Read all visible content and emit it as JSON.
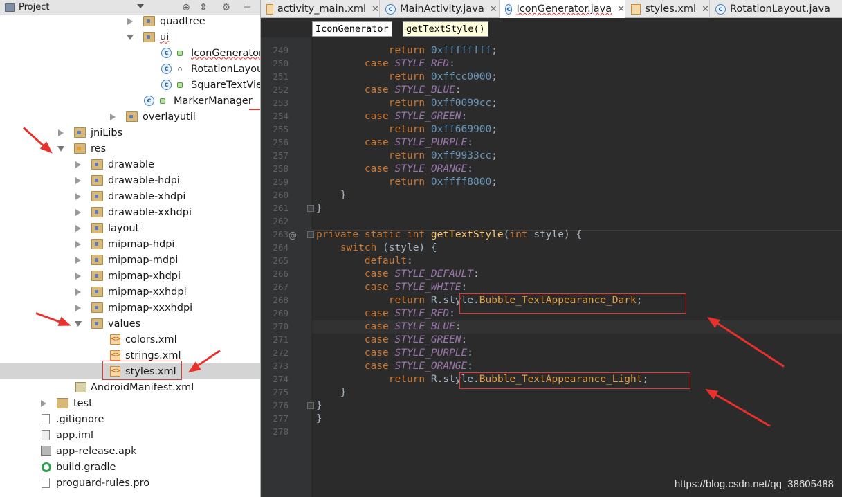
{
  "project_panel": {
    "title": "Project",
    "header_icons": [
      "target-icon",
      "collapse-icon",
      "gear-icon",
      "hide-icon"
    ],
    "tree": [
      {
        "label": "quadtree",
        "type": "folder"
      },
      {
        "label": "ui",
        "type": "folder"
      },
      {
        "label": "IconGenerator",
        "type": "class"
      },
      {
        "label": "RotationLayout",
        "type": "class"
      },
      {
        "label": "SquareTextView",
        "type": "class"
      },
      {
        "label": "MarkerManager",
        "type": "class"
      },
      {
        "label": "overlayutil",
        "type": "folder"
      },
      {
        "label": "jniLibs",
        "type": "folder"
      },
      {
        "label": "res",
        "type": "folder"
      },
      {
        "label": "drawable",
        "type": "folder"
      },
      {
        "label": "drawable-hdpi",
        "type": "folder"
      },
      {
        "label": "drawable-xhdpi",
        "type": "folder"
      },
      {
        "label": "drawable-xxhdpi",
        "type": "folder"
      },
      {
        "label": "layout",
        "type": "folder"
      },
      {
        "label": "mipmap-hdpi",
        "type": "folder"
      },
      {
        "label": "mipmap-mdpi",
        "type": "folder"
      },
      {
        "label": "mipmap-xhdpi",
        "type": "folder"
      },
      {
        "label": "mipmap-xxhdpi",
        "type": "folder"
      },
      {
        "label": "mipmap-xxxhdpi",
        "type": "folder"
      },
      {
        "label": "values",
        "type": "folder"
      },
      {
        "label": "colors.xml",
        "type": "xml"
      },
      {
        "label": "strings.xml",
        "type": "xml"
      },
      {
        "label": "styles.xml",
        "type": "xml",
        "selected": true
      },
      {
        "label": "AndroidManifest.xml",
        "type": "manifest"
      },
      {
        "label": "test",
        "type": "folder"
      },
      {
        "label": ".gitignore",
        "type": "file"
      },
      {
        "label": "app.iml",
        "type": "file"
      },
      {
        "label": "app-release.apk",
        "type": "apk"
      },
      {
        "label": "build.gradle",
        "type": "gradle"
      },
      {
        "label": "proguard-rules.pro",
        "type": "file"
      }
    ]
  },
  "tabs": [
    {
      "label": "activity_main.xml",
      "icon": "xml-file-icon",
      "active": false
    },
    {
      "label": "MainActivity.java",
      "icon": "java-class-icon",
      "active": false
    },
    {
      "label": "IconGenerator.java",
      "icon": "java-class-icon",
      "active": true
    },
    {
      "label": "styles.xml",
      "icon": "xml-file-icon",
      "active": false
    },
    {
      "label": "RotationLayout.java",
      "icon": "java-class-icon",
      "active": false
    }
  ],
  "breadcrumb": [
    "IconGenerator",
    "getTextStyle()"
  ],
  "editor": {
    "lines": [
      {
        "n": "249",
        "code": "            return 0xffffffff;"
      },
      {
        "n": "250",
        "code": "        case STYLE_RED:"
      },
      {
        "n": "251",
        "code": "            return 0xffcc0000;"
      },
      {
        "n": "252",
        "code": "        case STYLE_BLUE:"
      },
      {
        "n": "253",
        "code": "            return 0xff0099cc;"
      },
      {
        "n": "254",
        "code": "        case STYLE_GREEN:"
      },
      {
        "n": "255",
        "code": "            return 0xff669900;"
      },
      {
        "n": "256",
        "code": "        case STYLE_PURPLE:"
      },
      {
        "n": "257",
        "code": "            return 0xff9933cc;"
      },
      {
        "n": "258",
        "code": "        case STYLE_ORANGE:"
      },
      {
        "n": "259",
        "code": "            return 0xffff8800;"
      },
      {
        "n": "260",
        "code": "    }"
      },
      {
        "n": "261",
        "code": "}"
      },
      {
        "n": "262",
        "code": ""
      },
      {
        "n": "263",
        "code": "private static int getTextStyle(int style) {"
      },
      {
        "n": "264",
        "code": "    switch (style) {"
      },
      {
        "n": "265",
        "code": "        default:"
      },
      {
        "n": "266",
        "code": "        case STYLE_DEFAULT:"
      },
      {
        "n": "267",
        "code": "        case STYLE_WHITE:"
      },
      {
        "n": "268",
        "code": "            return R.style.Bubble_TextAppearance_Dark;"
      },
      {
        "n": "269",
        "code": "        case STYLE_RED:"
      },
      {
        "n": "270",
        "code": "        case STYLE_BLUE:"
      },
      {
        "n": "271",
        "code": "        case STYLE_GREEN:"
      },
      {
        "n": "272",
        "code": "        case STYLE_PURPLE:"
      },
      {
        "n": "273",
        "code": "        case STYLE_ORANGE:"
      },
      {
        "n": "274",
        "code": "            return R.style.Bubble_TextAppearance_Light;"
      },
      {
        "n": "275",
        "code": "    }"
      },
      {
        "n": "276",
        "code": "}"
      },
      {
        "n": "277",
        "code": "}"
      },
      {
        "n": "278",
        "code": ""
      }
    ]
  },
  "watermark": "https://blog.csdn.net/qq_38605488",
  "colors": {
    "editor_bg": "#2b2b2b",
    "keyword": "#cc7832",
    "constant": "#9876aa",
    "number": "#6897bb",
    "method": "#ffc66d",
    "annotation_red": "#e8302c"
  }
}
